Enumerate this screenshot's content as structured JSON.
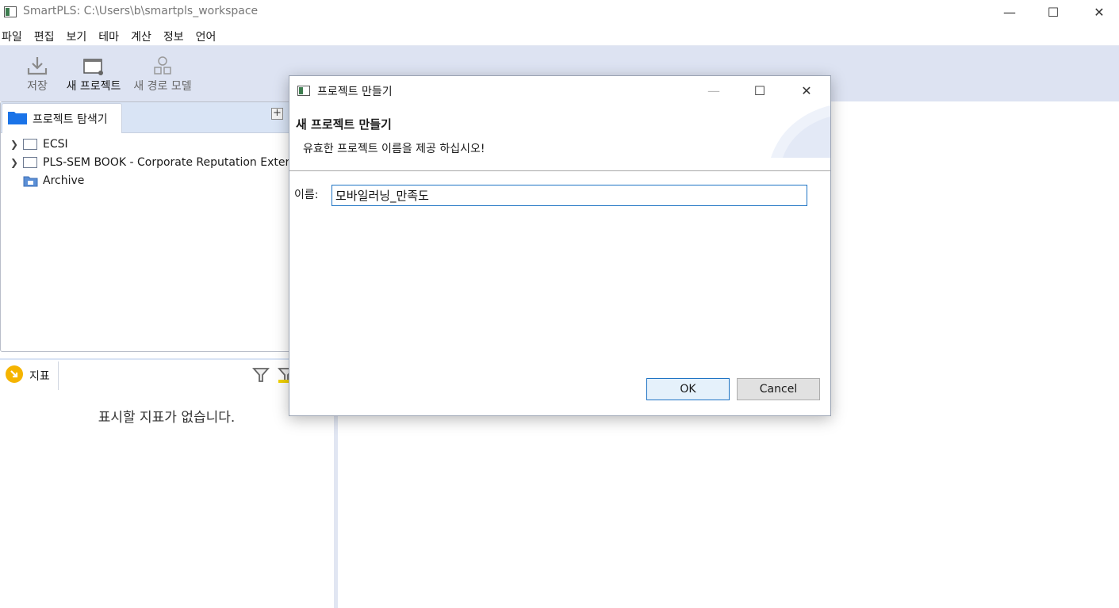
{
  "window": {
    "title": "SmartPLS: C:\\Users\\b\\smartpls_workspace",
    "minimize": "—",
    "maximize": "☐",
    "close": "✕"
  },
  "menu": [
    "파일",
    "편집",
    "보기",
    "테마",
    "계산",
    "정보",
    "언어"
  ],
  "toolbar": {
    "save": "저장",
    "new_project": "새 프로젝트",
    "new_path_model": "새 경로 모델"
  },
  "explorer": {
    "tab_label": "프로젝트 탐색기",
    "items": [
      {
        "label": "ECSI",
        "expandable": true
      },
      {
        "label": "PLS-SEM BOOK - Corporate Reputation Exter",
        "expandable": true
      },
      {
        "label": "Archive",
        "expandable": false
      }
    ]
  },
  "indicators": {
    "tab_label": "지표",
    "empty_message": "표시할 지표가 없습니다."
  },
  "dialog": {
    "title": "프로젝트 만들기",
    "header_title": "새 프로젝트 만들기",
    "header_message": "유효한 프로젝트 이름을 제공 하십시오!",
    "name_label": "이름:",
    "name_value": "모바일러닝_만족도",
    "ok_label": "OK",
    "cancel_label": "Cancel"
  },
  "colors": {
    "toolbar_bg": "#dde3f2",
    "accent": "#1f74c4",
    "folder": "#1a73e8",
    "indicator_icon": "#f5b400"
  }
}
